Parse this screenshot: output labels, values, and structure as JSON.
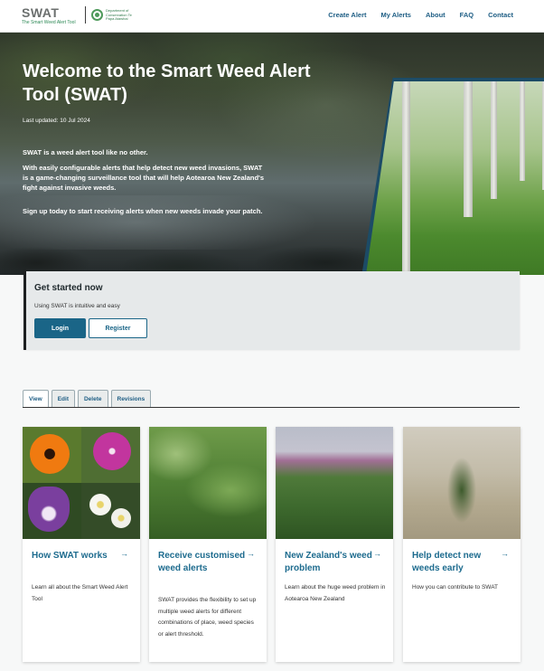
{
  "header": {
    "logo_main": "SWAT",
    "logo_sub": "The Smart Weed Alert Tool",
    "partner_logo_text": "Department of Conservation Te Papa Atawhai",
    "nav": [
      "Create Alert",
      "My Alerts",
      "About",
      "FAQ",
      "Contact"
    ]
  },
  "hero": {
    "title": "Welcome to the Smart Weed Alert Tool (SWAT)",
    "updated": "Last updated: 10 Jul 2024",
    "paragraphs": [
      "SWAT is a weed alert tool like no other.",
      "With easily configurable alerts that help detect new weed invasions, SWAT is a game-changing surveillance tool that will help Aotearoa New Zealand's fight against invasive weeds.",
      "Sign up today to start receiving alerts when new weeds invade your patch."
    ]
  },
  "get_started": {
    "title": "Get started now",
    "text": "Using SWAT is intuitive and easy",
    "login_label": "Login",
    "register_label": "Register"
  },
  "tabs": [
    "View",
    "Edit",
    "Delete",
    "Revisions"
  ],
  "cards": [
    {
      "title": "How SWAT works",
      "description": "Learn all about the Smart Weed Alert Tool",
      "arrow": "→"
    },
    {
      "title": "Receive customised weed alerts",
      "description": "SWAT provides the flexibility to set up multiple weed alerts for different combinations of place, weed species or alert threshold.",
      "arrow": "→"
    },
    {
      "title": "New Zealand's weed problem",
      "description": "Learn about the huge weed problem in Aotearoa New Zealand",
      "arrow": "→"
    },
    {
      "title": "Help detect new weeds early",
      "description": "How you can contribute to SWAT",
      "arrow": "→"
    }
  ],
  "colors": {
    "brand_blue": "#1a6587",
    "link_blue": "#1d5d84",
    "card_title": "#1d6b8e",
    "logo_green": "#2f8a57"
  }
}
